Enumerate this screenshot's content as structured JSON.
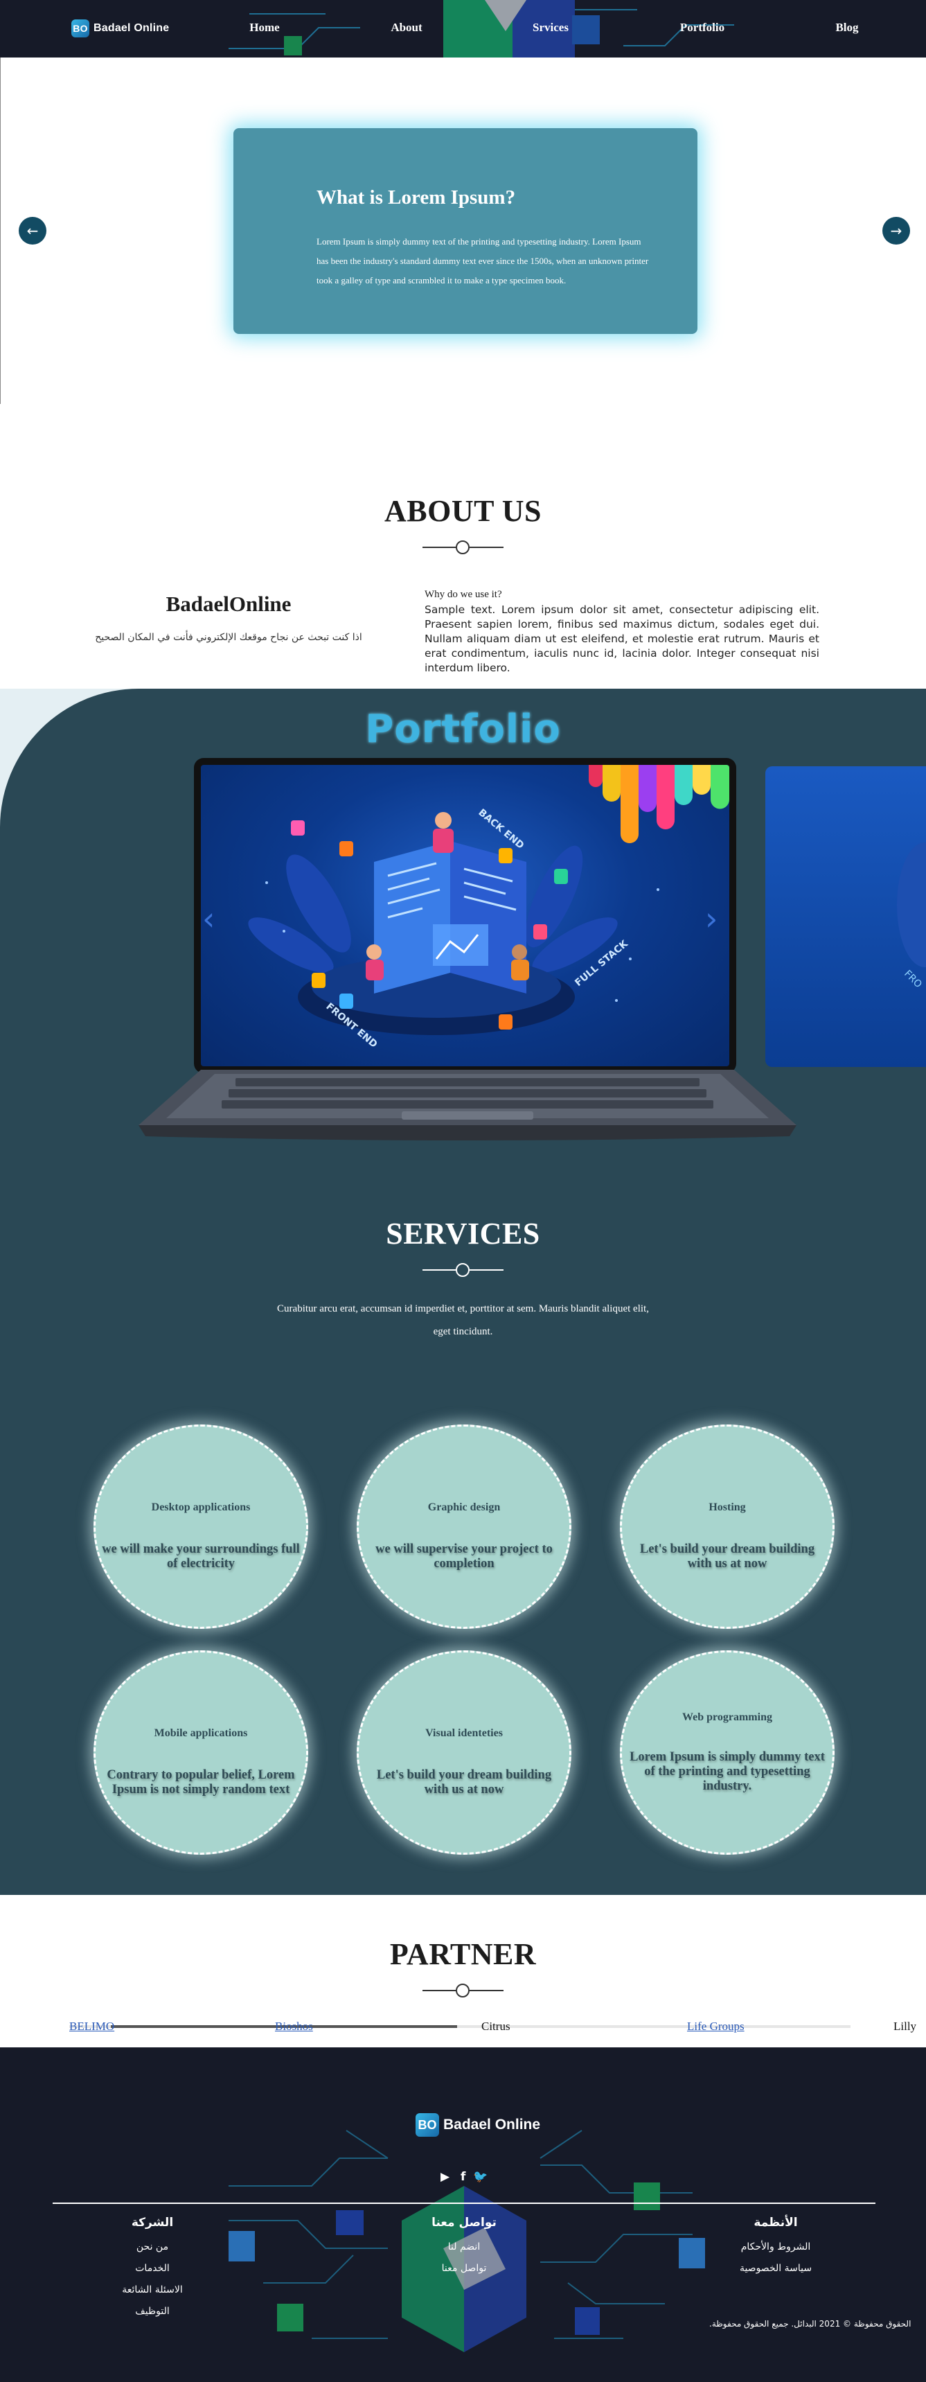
{
  "nav": {
    "logo_mark": "BO",
    "logo_text": "Badael Online",
    "links": [
      "Home",
      "About",
      "Srvices",
      "Portfolio",
      "Blog"
    ]
  },
  "slider": {
    "title": "What is Lorem Ipsum?",
    "text": "Lorem Ipsum is simply dummy text of the printing and typesetting industry. Lorem Ipsum has been the industry's standard dummy text ever since the 1500s, when an unknown printer took a galley of type and scrambled it to make a type specimen book.",
    "prev_icon": "←",
    "next_icon": "→"
  },
  "about": {
    "title": "ABOUT US",
    "brand": "BadaelOnline",
    "tagline": "اذا كنت تبحث عن نجاح موقعك الإلكتروني فأنت في المكان الصحيح",
    "question": "Why do we use it?",
    "body": "Sample text. Lorem ipsum dolor sit amet, consectetur adipiscing elit. Praesent sapien lorem, finibus sed maximus dictum, sodales eget dui. Nullam aliquam diam ut est eleifend, et molestie erat rutrum. Mauris et erat condimentum, iaculis nunc id, lacinia dolor. Integer consequat nisi interdum libero."
  },
  "portfolio": {
    "title": "Portfolio",
    "screen_labels": [
      "BACK END",
      "FRONT END",
      "FULL STACK"
    ],
    "prev_icon": "‹",
    "next_icon": "›"
  },
  "services": {
    "title": "SERVICES",
    "description": "Curabitur arcu erat, accumsan id imperdiet et, porttitor at sem. Mauris blandit aliquet elit, eget tincidunt.",
    "items": [
      {
        "title": "Desktop applications",
        "text": "we will make your surroundings full of electricity"
      },
      {
        "title": "Graphic design",
        "text": "we will supervise your project to completion"
      },
      {
        "title": "Hosting",
        "text": "Let's build your dream building with us at now"
      },
      {
        "title": "Mobile applications",
        "text": "Contrary to popular belief, Lorem Ipsum is not simply random text"
      },
      {
        "title": "Visual identeties",
        "text": "Let's build your dream building with us at now"
      },
      {
        "title": "Web programming",
        "text": "Lorem Ipsum is simply dummy text of the printing and typesetting industry."
      }
    ]
  },
  "partner": {
    "title": "PARTNER",
    "items": [
      "BELIMO",
      "Bioshos",
      "Citrus",
      "Life Groups",
      "Lilly"
    ]
  },
  "footer": {
    "logo_mark": "BO",
    "logo_text": "Badael Online",
    "social_icons": [
      "youtube-icon",
      "facebook-icon",
      "twitter-icon"
    ],
    "social_glyphs": [
      "▶",
      "f",
      "🐦"
    ],
    "columns": [
      {
        "title": "الشركة",
        "links": [
          "من نحن",
          "الخدمات",
          "الاسئلة الشائعة",
          "التوظيف"
        ]
      },
      {
        "title": "تواصل معنا",
        "links": [
          "انضم لنا",
          "تواصل معنا"
        ]
      },
      {
        "title": "الأنظمة",
        "links": [
          "الشروط والأحكام",
          "سياسة الخصوصية"
        ]
      }
    ],
    "copyright": "الحقوق محفوظة © 2021 البدائل. جميع الحقوق محفوظة."
  },
  "colors": {
    "nav_bg": "#161a28",
    "slide_card": "#4b93a6",
    "section_dark": "#2a4855",
    "circle_fill": "#a8d5ce",
    "portfolio_title": "#3fb3e0"
  }
}
